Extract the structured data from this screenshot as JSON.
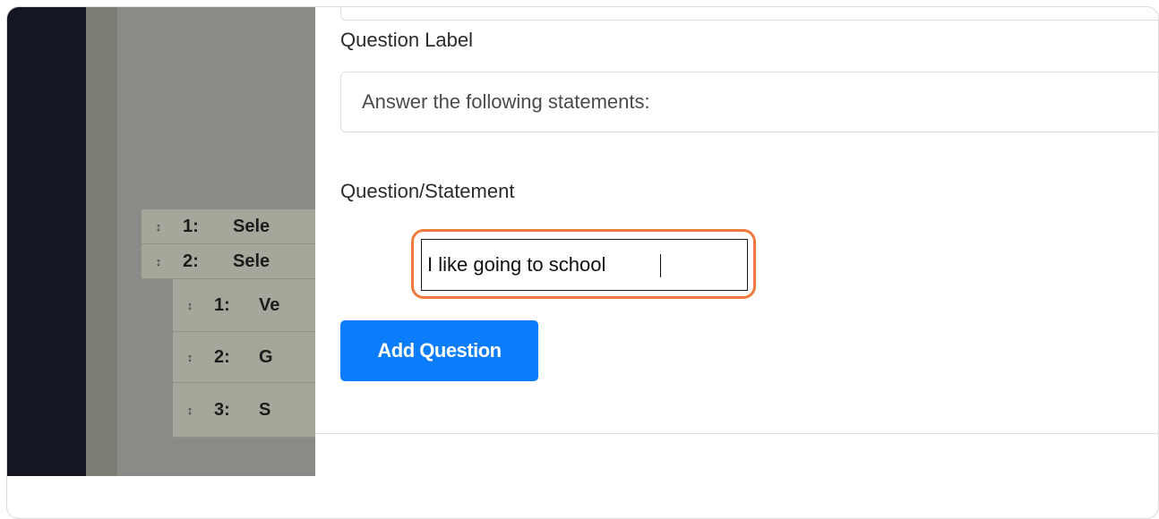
{
  "form": {
    "question_label_title": "Question Label",
    "question_label_value": "Answer the following statements:",
    "statement_title": "Question/Statement",
    "statement_value": "I like going to school",
    "add_button_label": "Add Question"
  },
  "background_list": {
    "rows": [
      {
        "handle": "↕",
        "num": "1:",
        "text": "Sele"
      },
      {
        "handle": "↕",
        "num": "2:",
        "text": "Sele"
      },
      {
        "handle": "↕",
        "num": "1:",
        "text": "Ve"
      },
      {
        "handle": "↕",
        "num": "2:",
        "text": "G"
      },
      {
        "handle": "↕",
        "num": "3:",
        "text": "S"
      }
    ]
  },
  "colors": {
    "primary_button": "#0b7dfa",
    "focus_highlight": "#f07a3d",
    "sidebar": "#141722"
  }
}
